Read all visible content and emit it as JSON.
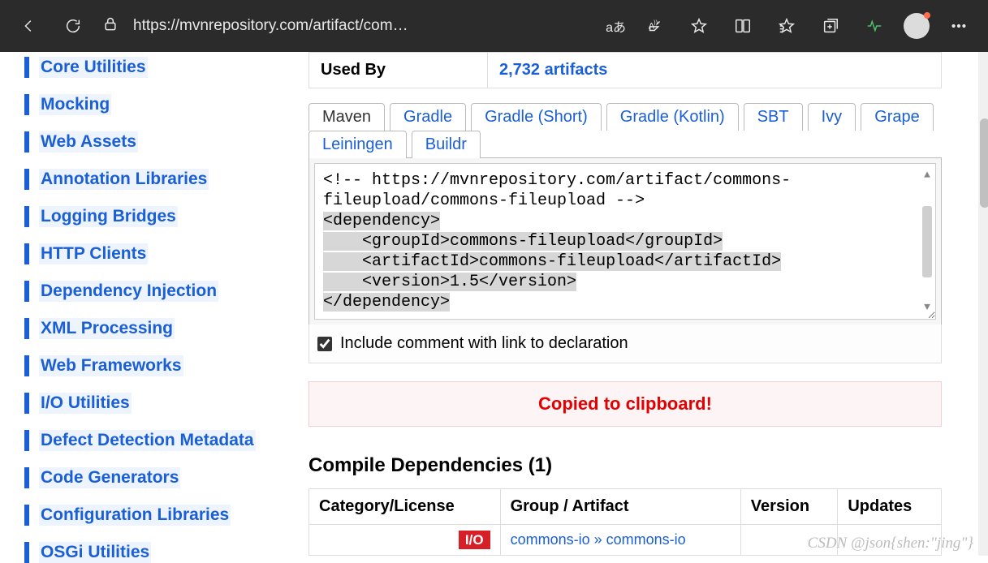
{
  "browser": {
    "url": "https://mvnrepository.com/artifact/com…",
    "translate": "aあ"
  },
  "sidebar": {
    "items": [
      {
        "label": "Core Utilities"
      },
      {
        "label": "Mocking"
      },
      {
        "label": "Web Assets"
      },
      {
        "label": "Annotation Libraries"
      },
      {
        "label": "Logging Bridges"
      },
      {
        "label": "HTTP Clients"
      },
      {
        "label": "Dependency Injection"
      },
      {
        "label": "XML Processing"
      },
      {
        "label": "Web Frameworks"
      },
      {
        "label": "I/O Utilities"
      },
      {
        "label": "Defect Detection Metadata"
      },
      {
        "label": "Code Generators"
      },
      {
        "label": "Configuration Libraries"
      },
      {
        "label": "OSGi Utilities"
      }
    ]
  },
  "info": {
    "usedByLabel": "Used By",
    "usedByValue": "2,732 artifacts"
  },
  "tabs": {
    "maven": "Maven",
    "gradle": "Gradle",
    "gradleShort": "Gradle (Short)",
    "gradleKotlin": "Gradle (Kotlin)",
    "sbt": "SBT",
    "ivy": "Ivy",
    "grape": "Grape",
    "leiningen": "Leiningen",
    "buildr": "Buildr"
  },
  "snippet": {
    "comment": "<!-- https://mvnrepository.com/artifact/commons-fileupload/commons-fileupload -->",
    "l1": "<dependency>",
    "l2": "    <groupId>commons-fileupload</groupId>",
    "l3": "    <artifactId>commons-fileupload</artifactId>",
    "l4": "    <version>1.5</version>",
    "l5": "</dependency>"
  },
  "includeComment": "Include comment with link to declaration",
  "copied": "Copied to clipboard!",
  "compileHeading": "Compile Dependencies (1)",
  "depTable": {
    "h1": "Category/License",
    "h2": "Group / Artifact",
    "h3": "Version",
    "h4": "Updates",
    "ioBadge": "I/O",
    "artifact": "commons-io » commons-io"
  },
  "watermark": "CSDN @json{shen:\"jing\"}"
}
